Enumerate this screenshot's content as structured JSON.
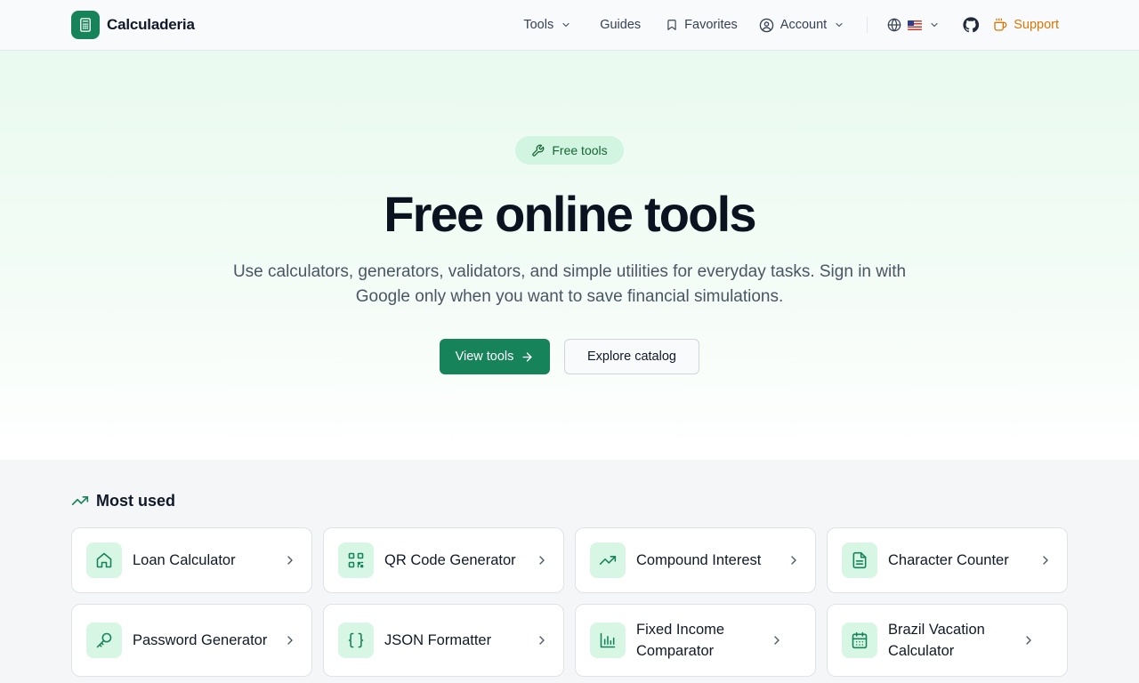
{
  "brand": {
    "name": "Calculaderia",
    "icon": "calculator-icon",
    "accent": "#17835a"
  },
  "nav": {
    "tools": "Tools",
    "guides": "Guides",
    "favorites": "Favorites",
    "account": "Account",
    "language_icon": "globe-icon",
    "language_flag": "us-flag",
    "github_icon": "github-icon",
    "support": "Support",
    "support_color": "#d97706"
  },
  "hero": {
    "badge": "Free tools",
    "title": "Free online tools",
    "subtitle": "Use calculators, generators, validators, and simple utilities for everyday tasks. Sign in with Google only when you want to save financial simulations.",
    "primary_button": "View tools",
    "secondary_button": "Explore catalog"
  },
  "most_used": {
    "title": "Most used",
    "icon": "trending-up-icon",
    "items": [
      {
        "label": "Loan Calculator",
        "icon": "home-icon"
      },
      {
        "label": "QR Code Generator",
        "icon": "qr-code-icon"
      },
      {
        "label": "Compound Interest",
        "icon": "trending-up-icon"
      },
      {
        "label": "Character Counter",
        "icon": "file-text-icon"
      },
      {
        "label": "Password Generator",
        "icon": "key-icon"
      },
      {
        "label": "JSON Formatter",
        "icon": "braces-icon"
      },
      {
        "label": "Fixed Income Comparator",
        "icon": "bar-chart-icon"
      },
      {
        "label": "Brazil Vacation Calculator",
        "icon": "calendar-icon"
      }
    ]
  }
}
